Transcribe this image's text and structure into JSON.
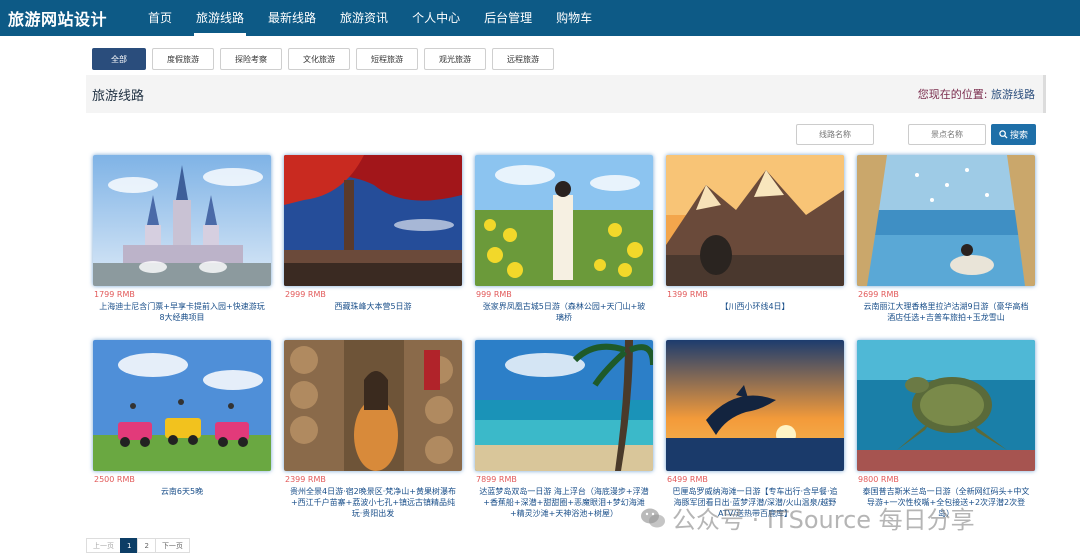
{
  "header": {
    "brand": "旅游网站设计",
    "nav": [
      "首页",
      "旅游线路",
      "最新线路",
      "旅游资讯",
      "个人中心",
      "后台管理",
      "购物车"
    ],
    "active_index": 1
  },
  "filters": [
    "全部",
    "度假旅游",
    "探险考察",
    "文化旅游",
    "短程旅游",
    "观光旅游",
    "远程旅游"
  ],
  "crumb": {
    "title": "旅游线路",
    "location_label": "您现在的位置:",
    "location_value": "旅游线路"
  },
  "search": {
    "route_placeholder": "线路名称",
    "spot_placeholder": "景点名称",
    "button": "搜索"
  },
  "cards": [
    {
      "price": "1799 RMB",
      "title": "上海迪士尼含门票+早享卡提前入园+快速游玩8大经典项目",
      "scene": "castle"
    },
    {
      "price": "2999 RMB",
      "title": "西藏珠峰大本营5日游",
      "scene": "tibet"
    },
    {
      "price": "999 RMB",
      "title": "张家界凤凰古城5日游（森林公园+天门山+玻璃桥",
      "scene": "flowers"
    },
    {
      "price": "1399 RMB",
      "title": "【川西小环线4日】",
      "scene": "mountain"
    },
    {
      "price": "2699 RMB",
      "title": "云南丽江大理香格里拉泸沽湖9日游（豪华高档酒店任选+吉普车旅拍+玉龙雪山",
      "scene": "lake"
    },
    {
      "price": "2500 RMB",
      "title": "云南6天5晚",
      "scene": "jeeps"
    },
    {
      "price": "2399 RMB",
      "title": "贵州全景4日游·宿2晚景区·梵净山+黄果树瀑布+西江千户苗寨+荔波小七孔+镇远古镇精品纯玩·贵阳出发",
      "scene": "girl"
    },
    {
      "price": "7899 RMB",
      "title": "达蓝梦岛双岛一日游 海上浮台（海底漫步+浮潜+香蕉船+深潜+甜甜圈+恶魔眼泪+梦幻海滩+精灵沙滩+天神浴池+树屋）",
      "scene": "beach"
    },
    {
      "price": "6499 RMB",
      "title": "巴厘岛罗威纳海滩一日游【专车出行·含早餐·追海豚军团看日出·蓝梦浮潜/深潜/火山温泉/越野ATV/送热带百鹿库】",
      "scene": "dolphin"
    },
    {
      "price": "9800 RMB",
      "title": "泰国普吉斯米兰岛一日游（全新网红码头+中文导游+一次性校嘴+全包接送+2次浮潜2次登岛）",
      "scene": "turtle"
    }
  ],
  "pager": {
    "prev": "上一页",
    "pages": [
      "1",
      "2"
    ],
    "current": "1",
    "next": "下一页"
  },
  "watermark": "公众号 · ITSource 每日分享"
}
